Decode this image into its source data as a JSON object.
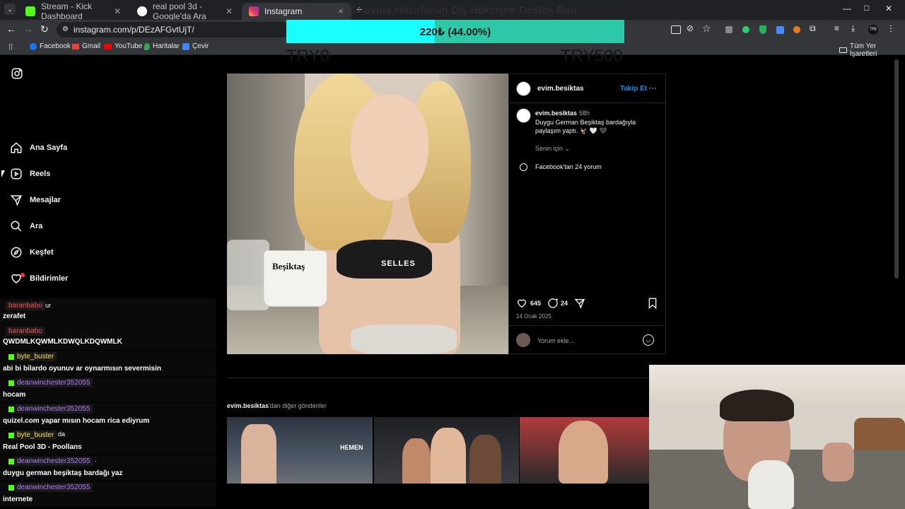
{
  "browser": {
    "tabs": [
      {
        "title": "Stream - Kick Dashboard",
        "favicon_color": "#53fc18"
      },
      {
        "title": "real pool 3d - Google'da Ara",
        "favicon_color": "#ffffff"
      },
      {
        "title": "Instagram",
        "favicon_color": "#e1306c"
      }
    ],
    "new_tab": "+",
    "url": "instagram.com/p/DEzAFGvtUjT/",
    "bookmarks": [
      "Facebook",
      "Gmail",
      "YouTube",
      "Haritalar",
      "Çevir"
    ],
    "all_bookmarks": "Tüm Yer İşaretleri",
    "window_controls": [
      "—",
      "□",
      "✕"
    ]
  },
  "overlay": {
    "title": "DUS Sınavına Hazırlanan Diş Hekimine Destek Barı",
    "bar_text": "220₺ (44.00%)",
    "progress": 0.44,
    "min_label": "TRY0",
    "max_label": "TRY500",
    "fill_color": "#19fefe",
    "bar_color": "#2dc8a8"
  },
  "sidebar": {
    "items": [
      {
        "label": "Ana Sayfa",
        "icon": "home-icon"
      },
      {
        "label": "Reels",
        "icon": "reels-icon"
      },
      {
        "label": "Mesajlar",
        "icon": "send-icon"
      },
      {
        "label": "Ara",
        "icon": "search-icon"
      },
      {
        "label": "Keşfet",
        "icon": "compass-icon"
      },
      {
        "label": "Bildirimler",
        "icon": "heart-icon"
      }
    ]
  },
  "chat": {
    "messages": [
      {
        "user": "baranbabo",
        "suffix": "ur",
        "text": "zerafet",
        "user_color": "#ff4d4d",
        "badge": ""
      },
      {
        "user": "baranbabo",
        "suffix": "",
        "text": "QWDMLKQWMLKDWQLKDQWMLK",
        "user_color": "#ff4d4d",
        "badge": ""
      },
      {
        "user": "byte_buster",
        "suffix": "",
        "text": "abi bi bilardo oyunuv ar oynarmısın severmisin",
        "user_color": "#ffe14d",
        "badge": "sub"
      },
      {
        "user": "deanwinchester352055",
        "suffix": "",
        "text": "hocam",
        "user_color": "#b57cff",
        "badge": "sub"
      },
      {
        "user": "deanwinchester352055",
        "suffix": "",
        "text": "quizel.com yapar mısın hocam rica ediyrum",
        "user_color": "#b57cff",
        "badge": "sub"
      },
      {
        "user": "byte_buster",
        "suffix": "da",
        "text": "Real Pool 3D - Poollans",
        "user_color": "#ffe14d",
        "badge": "sub"
      },
      {
        "user": "deanwinchester352055",
        "suffix": "·",
        "text": "duygu german beşiktaş bardağı yaz",
        "user_color": "#b57cff",
        "badge": "sub"
      },
      {
        "user": "deanwinchester352055",
        "suffix": "",
        "text": "internete",
        "user_color": "#b57cff",
        "badge": "sub"
      }
    ]
  },
  "post": {
    "author": "evim.besiktas",
    "follow": "Takip Et",
    "time": "58h",
    "caption": "Duygu German Beşiktaş bardağıyla paylaşım yaptı. 🦅 🤍 🖤",
    "translation_hint": "Senin için",
    "facebook_comments": "Facebook'tan 24 yorum",
    "likes": "645",
    "comments": "24",
    "date": "14 Ocak 2025",
    "comment_placeholder": "Yorum ekle...",
    "mug_text": "Beşiktaş",
    "bra_text": "SELLES"
  },
  "more_posts": {
    "author": "evim.besiktas",
    "suffix": "'dan diğer gönderiler",
    "thumb1_text": "HEMEN"
  }
}
